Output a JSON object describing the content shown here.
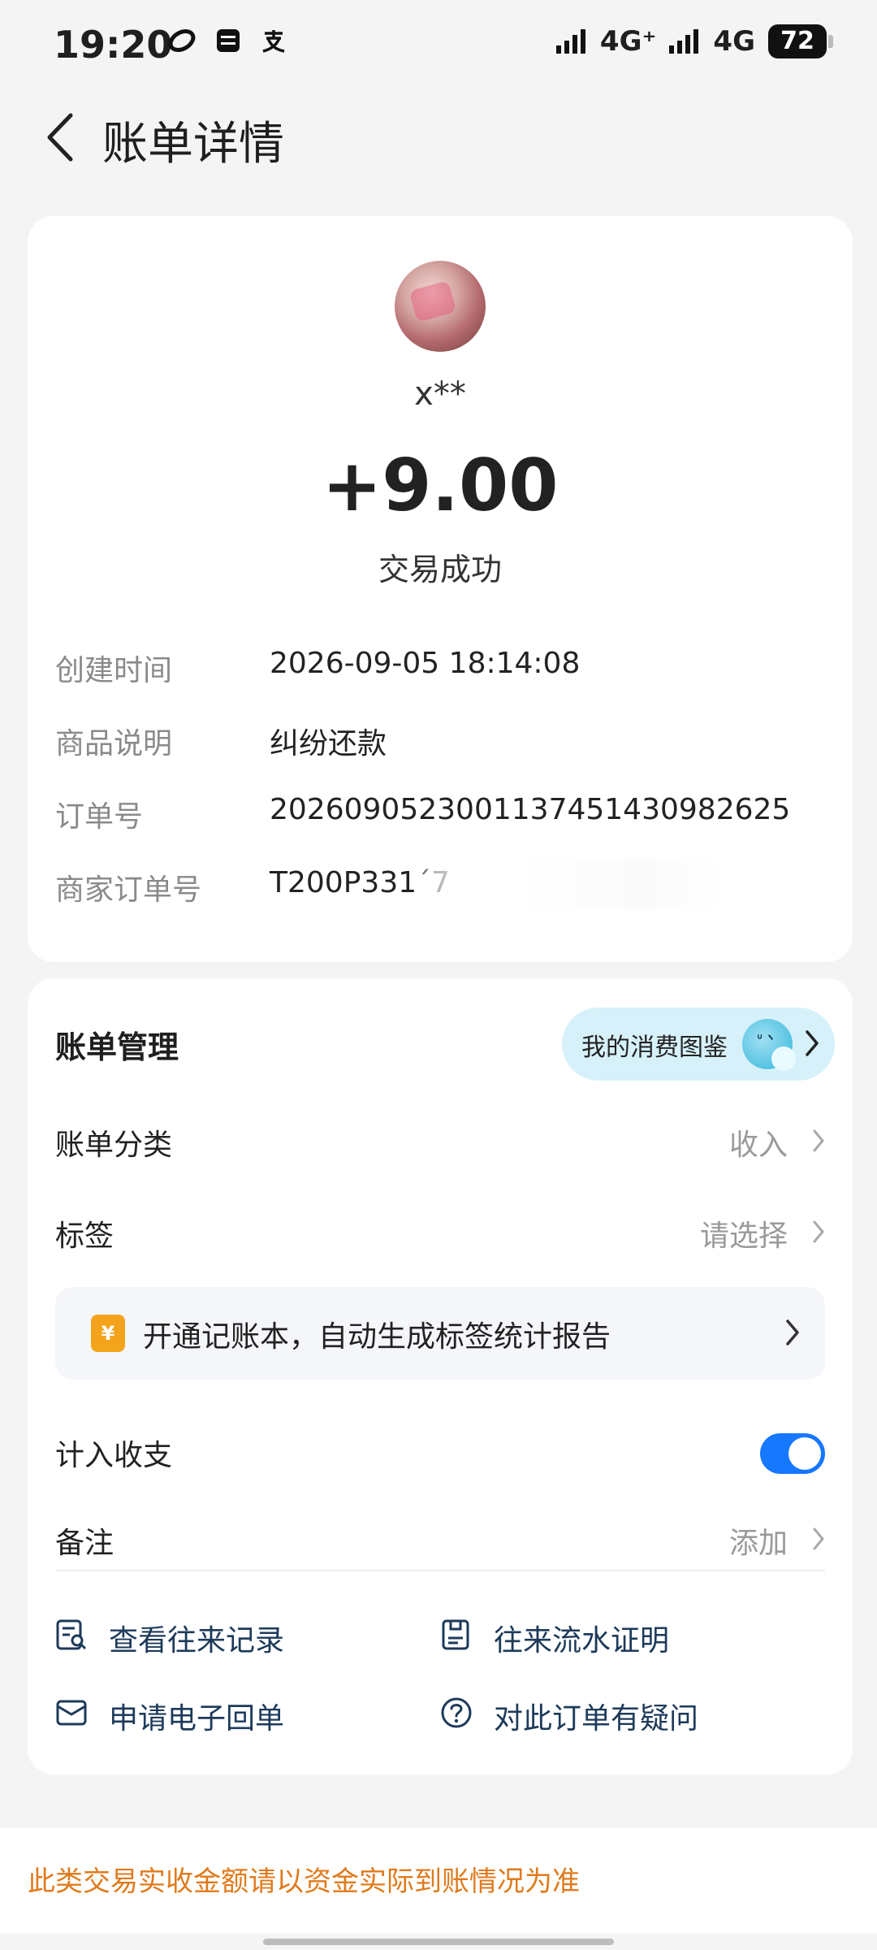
{
  "status_bar": {
    "time": "19:20",
    "network1": "4G⁺",
    "network2": "4G",
    "battery": "72"
  },
  "header": {
    "title": "账单详情"
  },
  "summary": {
    "payee": "x**",
    "amount": "+9.00",
    "status": "交易成功"
  },
  "details": [
    {
      "label": "创建时间",
      "value": "2026-09-05 18:14:08"
    },
    {
      "label": "商品说明",
      "value": "纠纷还款"
    },
    {
      "label": "订单号",
      "value": "2026090523001137451430982625"
    },
    {
      "label": "商家订单号",
      "value": "T200P331´7"
    }
  ],
  "management": {
    "title": "账单管理",
    "pill_label": "我的消费图鉴",
    "category": {
      "label": "账单分类",
      "value": "收入"
    },
    "tag": {
      "label": "标签",
      "value": "请选择"
    },
    "promo": {
      "icon_text": "¥",
      "text": "开通记账本，自动生成标签统计报告"
    },
    "include": {
      "label": "计入收支",
      "enabled": true
    },
    "note": {
      "label": "备注",
      "value": "添加"
    }
  },
  "actions": [
    {
      "label": "查看往来记录",
      "icon": "record-search-icon"
    },
    {
      "label": "往来流水证明",
      "icon": "statement-proof-icon"
    },
    {
      "label": "申请电子回单",
      "icon": "envelope-icon"
    },
    {
      "label": "对此订单有疑问",
      "icon": "question-icon"
    }
  ],
  "footer_note": "此类交易实收金额请以资金实际到账情况为准",
  "colors": {
    "accent": "#1677ff",
    "warning_text": "#e07a1c",
    "pill_bg": "#d7f1fa"
  }
}
